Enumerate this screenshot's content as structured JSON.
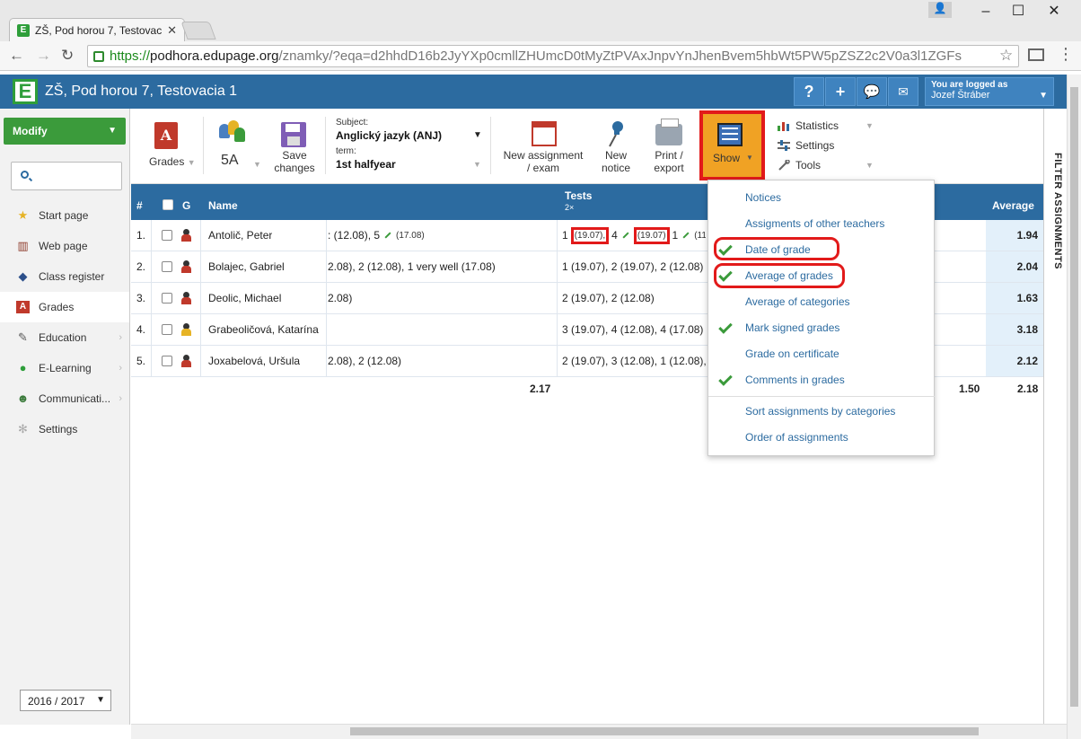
{
  "browser": {
    "tab_title": "ZŠ, Pod horou 7, Testovac",
    "tab_favicon": "E",
    "url_proto": "https://",
    "url_host": "podhora.edupage.org",
    "url_path": "/znamky/?eqa=d2hhdD16b2JyYXp0cmllZHUmcD0tMyZtPVAxJnpvYnJhenBvem5hbWt5PW5pZSZ2c2V0a3l1ZGFs"
  },
  "header": {
    "logo": "E",
    "title": "ZŠ, Pod horou 7, Testovacia 1",
    "help": "?",
    "add": "+",
    "logged_as_label": "You are logged as",
    "user_name": "Jozef Štráber"
  },
  "sidebar": {
    "modify_label": "Modify",
    "search_placeholder": "",
    "items": [
      {
        "label": "Start page",
        "icon": "star-icon"
      },
      {
        "label": "Web page",
        "icon": "books-icon"
      },
      {
        "label": "Class register",
        "icon": "register-icon"
      },
      {
        "label": "Grades",
        "icon": "grades-icon"
      },
      {
        "label": "Education",
        "icon": "education-icon"
      },
      {
        "label": "E-Learning",
        "icon": "elearning-icon"
      },
      {
        "label": "Communicati...",
        "icon": "communication-icon"
      },
      {
        "label": "Settings",
        "icon": "gear-icon"
      }
    ],
    "year": "2016 / 2017"
  },
  "toolbar": {
    "grades_label": "Grades",
    "class_label": "5A",
    "save_label_1": "Save",
    "save_label_2": "changes",
    "subject_label": "Subject:",
    "subject_value": "Anglický jazyk (ANJ)",
    "term_label": "term:",
    "term_value": "1st halfyear",
    "new_assignment_1": "New assignment",
    "new_assignment_2": "/ exam",
    "new_notice_1": "New",
    "new_notice_2": "notice",
    "print_1": "Print /",
    "print_2": "export",
    "show_label": "Show",
    "statistics": "Statistics",
    "settings": "Settings",
    "tools": "Tools"
  },
  "filter_label": "FILTER ASSIGNMENTS",
  "table": {
    "col_num": "#",
    "col_g": "G",
    "col_name": "Name",
    "col_tests": "Tests",
    "col_tests_sub": "2×",
    "col_avg": "Average",
    "rows": [
      {
        "num": "1.",
        "name": "Antolič, Peter",
        "g1": ": (12.08), 5",
        "g1b": "(17.08)",
        "t1": "1",
        "t1d": "(19.07),",
        "t2": "4",
        "t2d": "(19.07)",
        "t3": "1",
        "t3d": "(11.0",
        "avg": "1.94"
      },
      {
        "num": "2.",
        "name": "Bolajec, Gabriel",
        "g1": "2.08), 2 (12.08), 1 very well (17.08)",
        "tests": "1 (19.07), 2 (19.07), 2 (12.08)",
        "avg": "2.04"
      },
      {
        "num": "3.",
        "name": "Deolic, Michael",
        "g1": "2.08)",
        "tests": "2 (19.07), 2 (12.08)",
        "avg": "1.63"
      },
      {
        "num": "4.",
        "name": "Grabeoličová, Katarína",
        "g1": "",
        "tests": "3 (19.07), 4 (12.08), 4 (17.08)",
        "avg": "3.18"
      },
      {
        "num": "5.",
        "name": "Joxabelová, Uršula",
        "g1": "2.08), 2 (12.08)",
        "tests": "2 (19.07), 3 (12.08), 1 (12.08), 2",
        "avg": "2.12"
      }
    ],
    "footer_left": "2.17",
    "footer_mid": "1.50",
    "footer_avg": "2.18"
  },
  "show_menu": {
    "items": [
      {
        "label": "Notices",
        "checked": false
      },
      {
        "label": "Assigments of other teachers",
        "checked": false
      },
      {
        "label": "Date of grade",
        "checked": true
      },
      {
        "label": "Average of grades",
        "checked": true
      },
      {
        "label": "Average of categories",
        "checked": false
      },
      {
        "label": "Mark signed grades",
        "checked": true
      },
      {
        "label": "Grade on certificate",
        "checked": false
      },
      {
        "label": "Comments in grades",
        "checked": true
      },
      {
        "label": "Sort assignments by categories",
        "checked": false
      },
      {
        "label": "Order of assignments",
        "checked": false
      }
    ]
  },
  "colors": {
    "header_blue": "#2c6ba0",
    "modify_green": "#3b9b3b",
    "highlight_red": "#e21a1a",
    "show_orange": "#f0a224",
    "avg_cell": "#e3f0fa"
  }
}
